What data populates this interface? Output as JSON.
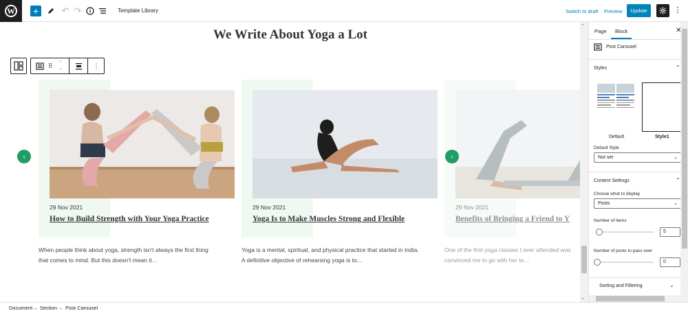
{
  "topbar": {
    "logo_letter": "W",
    "add_label": "+",
    "title": "Template Library",
    "switch_to_draft": "Switch to draft",
    "preview": "Preview",
    "update": "Update"
  },
  "canvas": {
    "page_title": "We Write About Yoga a Lot",
    "cards": [
      {
        "date": "29 Nov 2021",
        "title": "How to Build Strength with Your Yoga Practice",
        "excerpt_line1": "When people think about yoga, strength isn't always the first thing",
        "excerpt_line2": "that comes to mind. But this doesn't mean it…"
      },
      {
        "date": "29 Nov 2021",
        "title": "Yoga Is to Make Muscles Strong and Flexible",
        "excerpt_line1": "Yoga is a mental, spiritual, and physical practice that started in India.",
        "excerpt_line2": "A definitive objective of rehearsing yoga is to…"
      },
      {
        "date": "29 Nov 2021",
        "title": "Benefits of Bringing a Friend to Y",
        "excerpt_line1": "One of the first yoga classes I ever attended was",
        "excerpt_line2": "convinced me to go with her to…"
      }
    ]
  },
  "sidebar": {
    "tabs": [
      "Page",
      "Block"
    ],
    "active_tab": "Block",
    "block_name": "Post Carousel",
    "styles_heading": "Styles",
    "style_options": [
      "Default",
      "Style1"
    ],
    "selected_style": "Style1",
    "default_style_label": "Default Style",
    "default_style_value": "Not set",
    "content_settings_heading": "Content Settings",
    "display_label": "Choose what to display",
    "display_value": "Posts",
    "items_label": "Number of items",
    "items_value": "5",
    "pass_over_label": "Number of posts to pass over",
    "pass_over_value": "0",
    "sorting_heading": "Sorting and Filtering"
  },
  "breadcrumb": {
    "items": [
      "Document",
      "Section",
      "Post Carousel"
    ],
    "separator": "→"
  },
  "colors": {
    "accent": "#007cba",
    "nav_arrow": "#1f9d62",
    "card_tint": "#f0f8f2"
  }
}
